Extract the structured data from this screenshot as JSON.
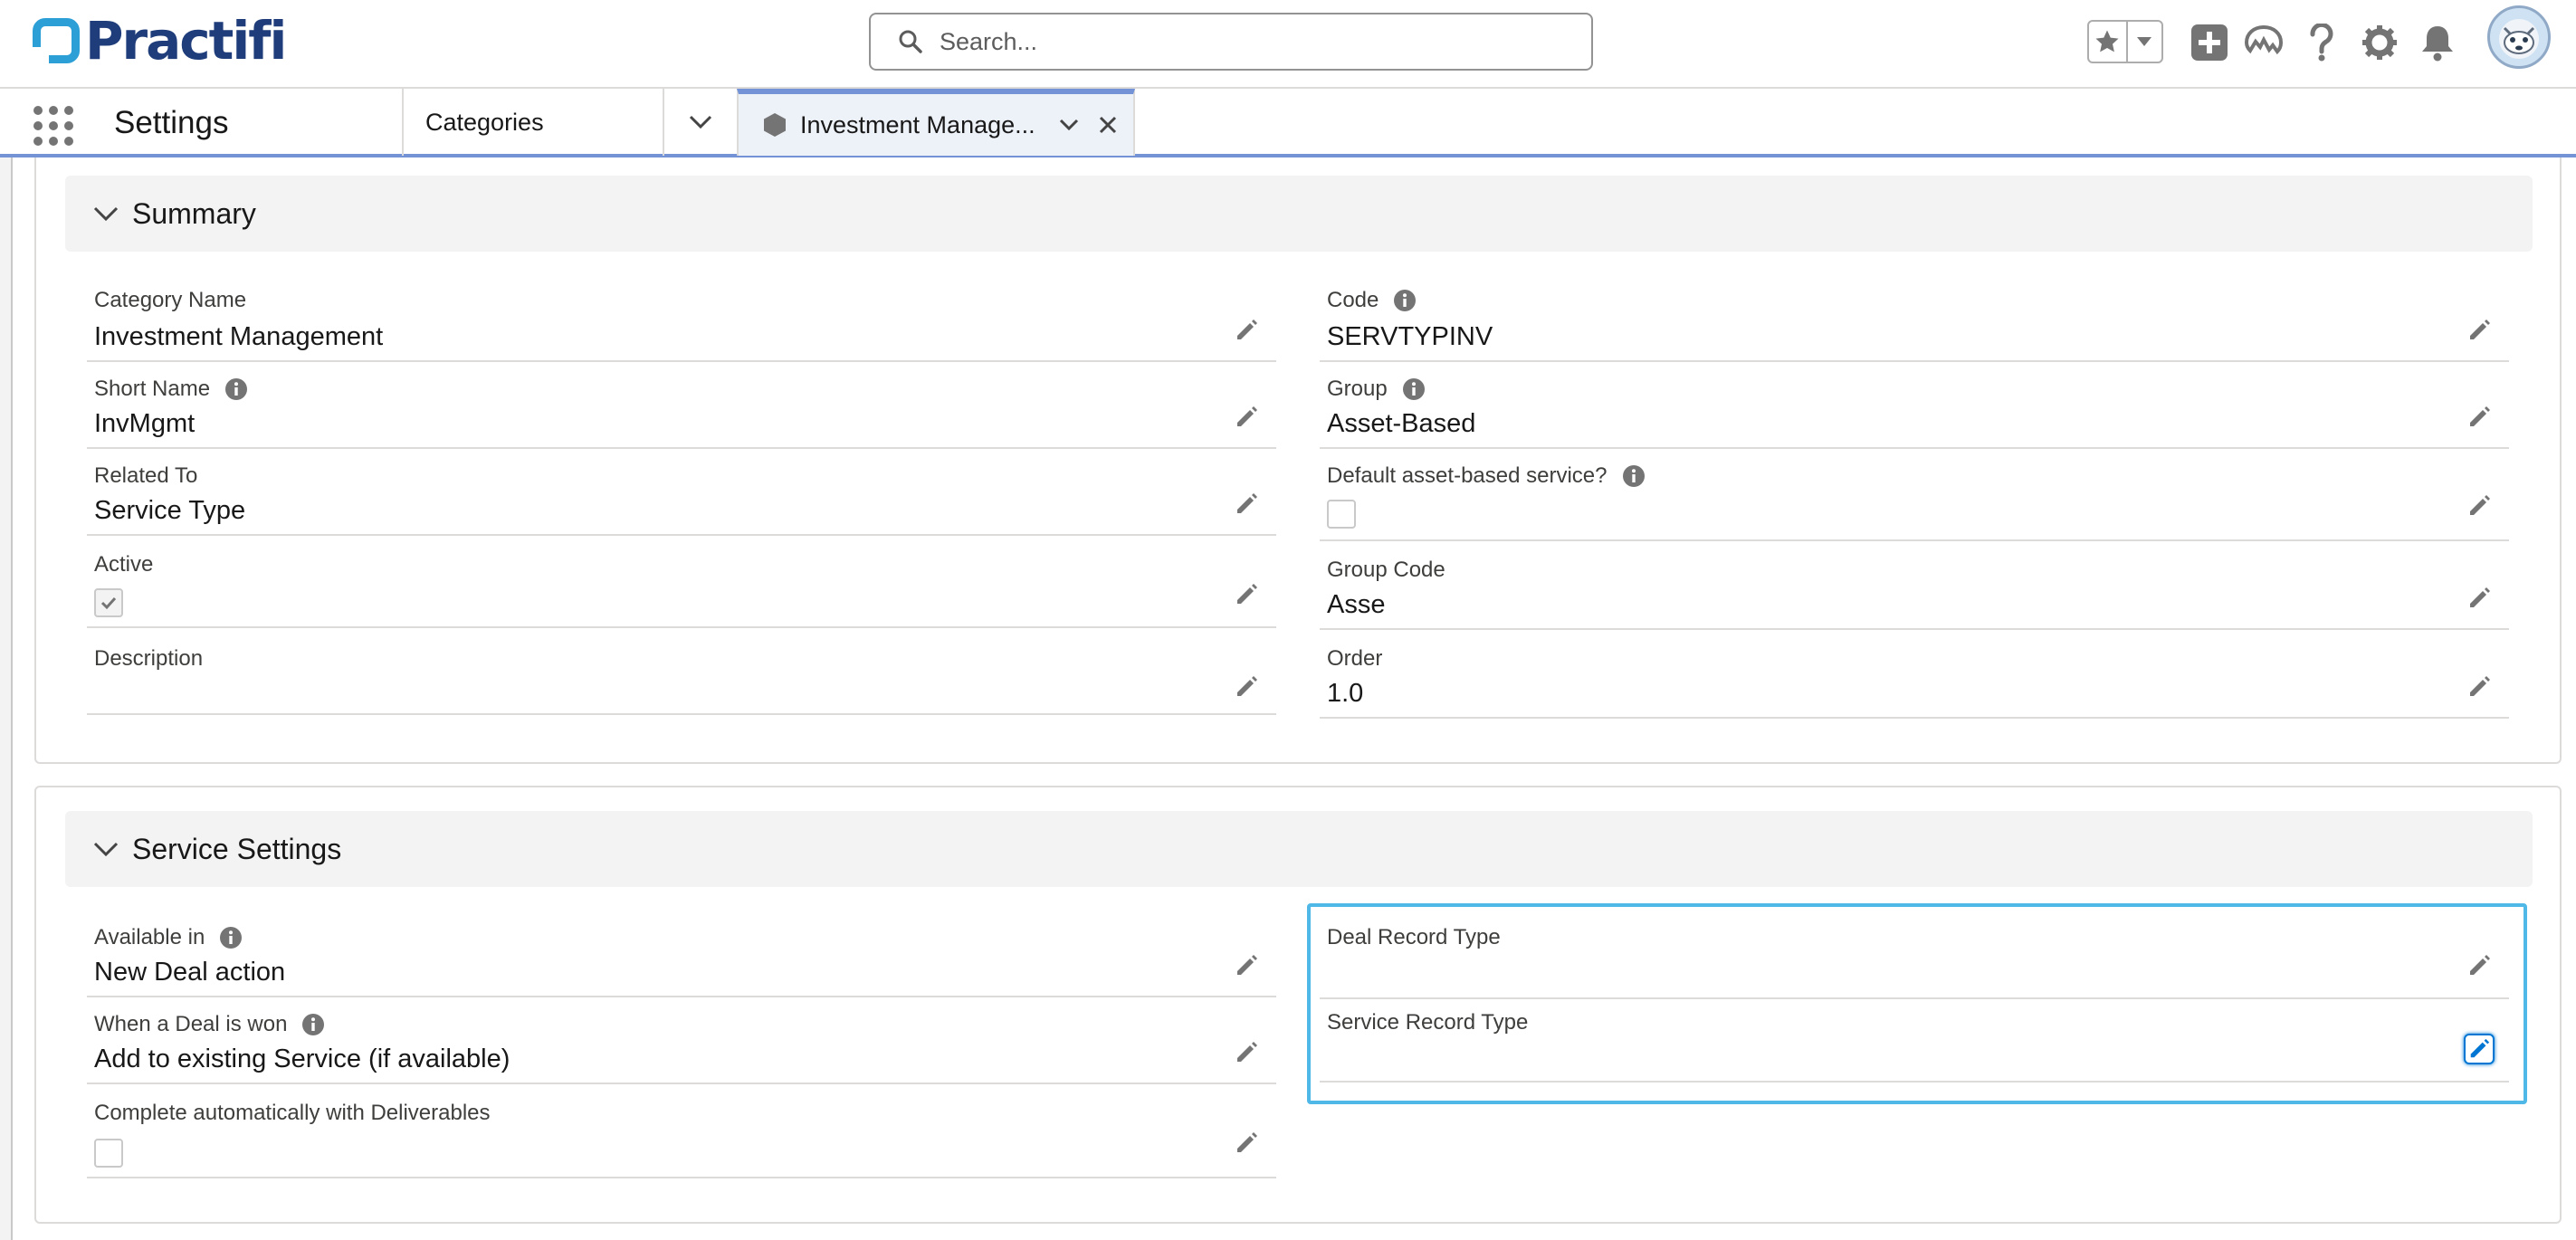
{
  "header": {
    "brand": "Practifi",
    "search_placeholder": "Search..."
  },
  "nav": {
    "app_name": "Settings",
    "tabs": [
      {
        "label": "Categories"
      },
      {
        "label": "Investment Manage..."
      }
    ]
  },
  "summary": {
    "title": "Summary",
    "left_fields": [
      {
        "label": "Category Name",
        "value": "Investment Management"
      },
      {
        "label": "Short Name",
        "value": "InvMgmt"
      },
      {
        "label": "Related To",
        "value": "Service Type"
      },
      {
        "label": "Active",
        "checked": true
      },
      {
        "label": "Description",
        "value": ""
      }
    ],
    "right_fields": [
      {
        "label": "Code",
        "value": "SERVTYPINV"
      },
      {
        "label": "Group",
        "value": "Asset-Based"
      },
      {
        "label": "Default asset-based service?",
        "checked": false
      },
      {
        "label": "Group Code",
        "value": "Asse"
      },
      {
        "label": "Order",
        "value": "1.0"
      }
    ]
  },
  "service": {
    "title": "Service Settings",
    "left_fields": [
      {
        "label": "Available in",
        "value": "New Deal action"
      },
      {
        "label": "When a Deal is won",
        "value": "Add to existing Service (if available)"
      },
      {
        "label": "Complete automatically with Deliverables",
        "checked": false
      }
    ],
    "right_fields": [
      {
        "label": "Deal Record Type",
        "value": ""
      },
      {
        "label": "Service Record Type",
        "value": ""
      }
    ]
  },
  "colors": {
    "brand_blue": "#1f3d7a",
    "accent": "#7393d6",
    "focus": "#4fb8e6"
  }
}
